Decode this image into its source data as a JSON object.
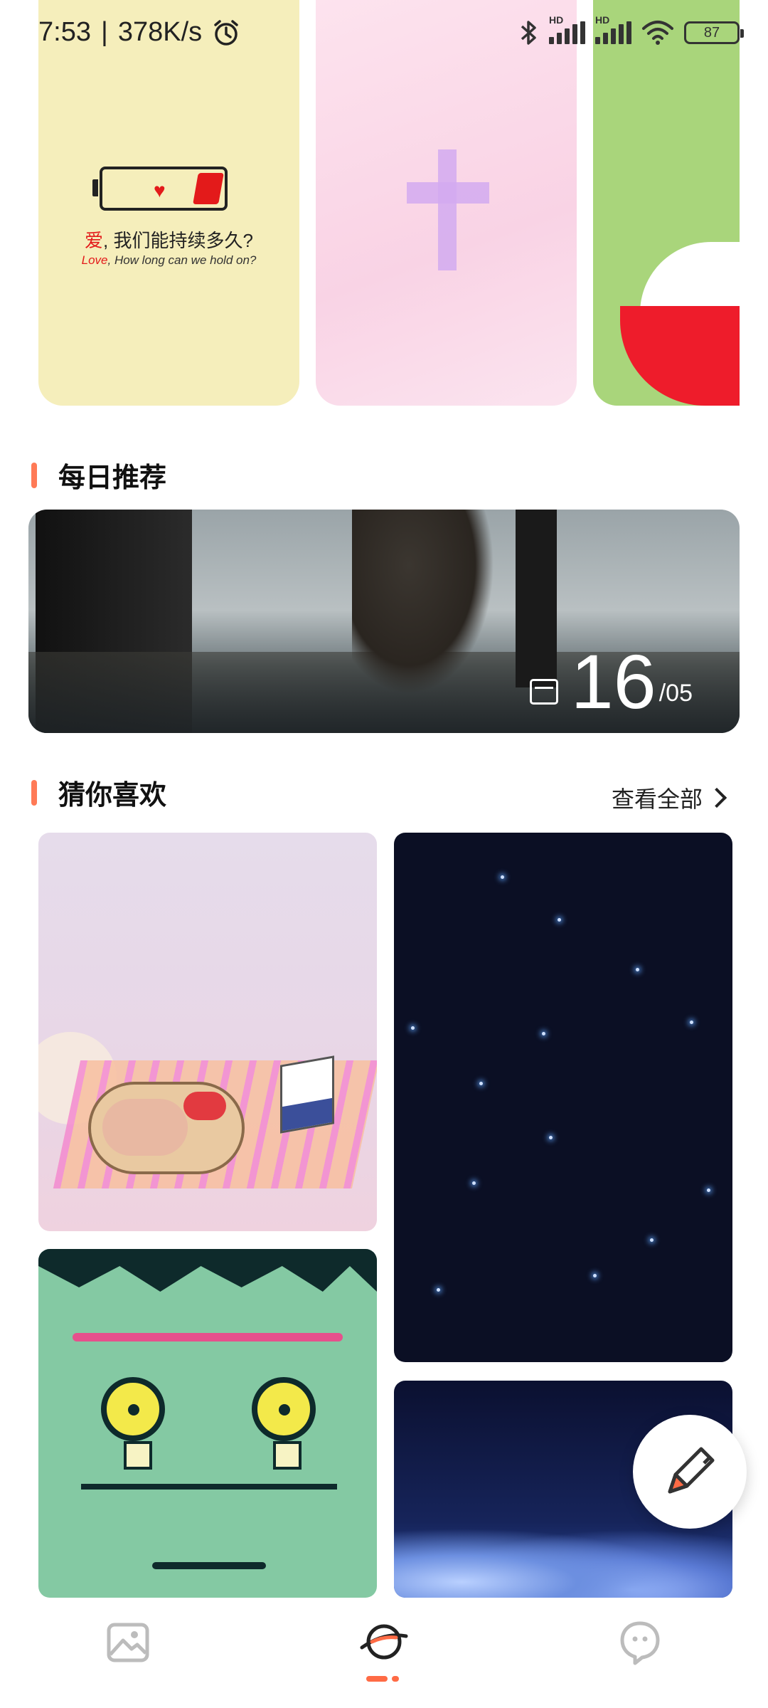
{
  "status_bar": {
    "time": "7:53",
    "net_speed": "378K/s",
    "battery": "87",
    "signal_label": "HD"
  },
  "top_cards": [
    {
      "cn_prefix": "爱",
      "cn_text": ", 我们能持续多久?",
      "en_prefix": "Love",
      "en_text": ", How long can we hold on?"
    },
    {
      "name": "pink-cross"
    },
    {
      "name": "green-red"
    }
  ],
  "daily": {
    "title": "每日推荐",
    "day": "16",
    "month": "/05"
  },
  "guess": {
    "title": "猜你喜欢",
    "view_all": "查看全部"
  },
  "colors": {
    "accent": "#ff7a56",
    "nav_active": "#ff6b45"
  },
  "nav": {
    "items": [
      {
        "icon": "gallery-icon"
      },
      {
        "icon": "planet-icon"
      },
      {
        "icon": "chat-icon"
      }
    ]
  }
}
